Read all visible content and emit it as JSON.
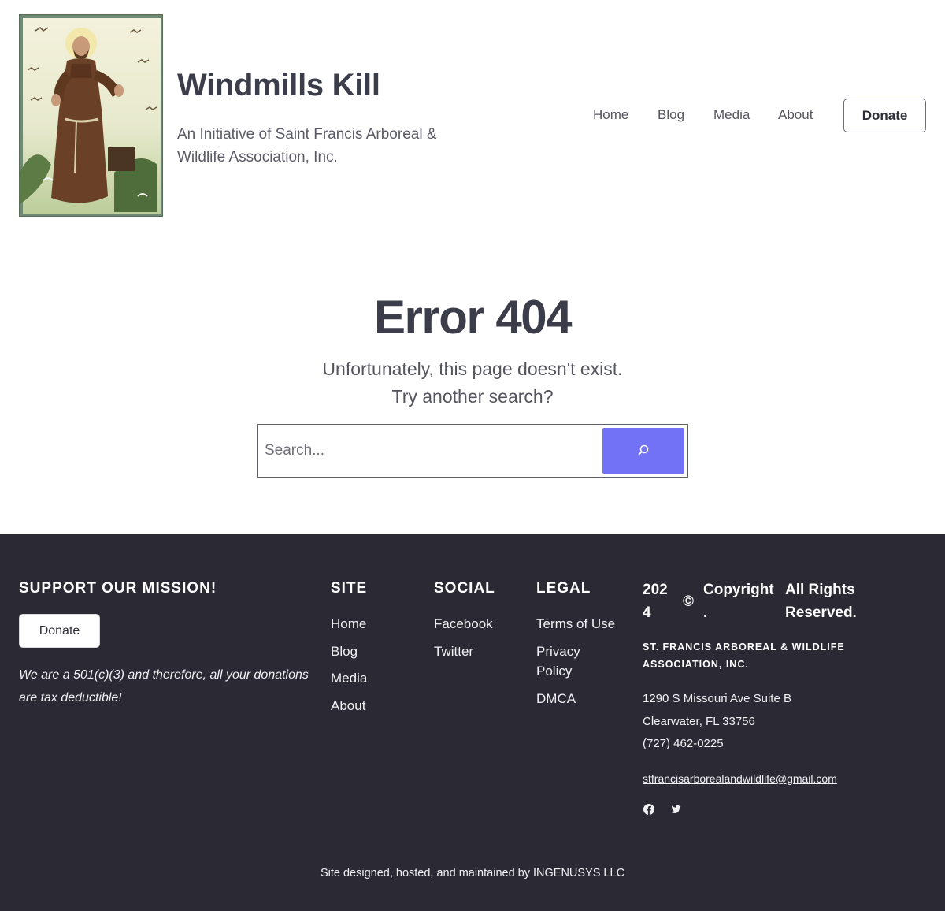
{
  "header": {
    "title": "Windmills Kill",
    "tagline": "An Initiative of Saint Francis Arboreal & Wildlife Association, Inc.",
    "nav": [
      {
        "label": "Home"
      },
      {
        "label": "Blog"
      },
      {
        "label": "Media"
      },
      {
        "label": "About"
      }
    ],
    "donate_label": "Donate"
  },
  "main": {
    "error_title": "Error 404",
    "message_line1": "Unfortunately, this page doesn't exist.",
    "message_line2": "Try another search?",
    "search_placeholder": "Search...",
    "search_button_icon": "search-icon",
    "accent_color": "#7272f7"
  },
  "footer": {
    "background_color": "#2a2934",
    "mission": {
      "heading": "SUPPORT OUR MISSION!",
      "donate_label": "Donate",
      "note": "We are a 501(c)(3) and therefore, all your donations are tax deductible!"
    },
    "site": {
      "heading": "SITE",
      "links": [
        "Home",
        "Blog",
        "Media",
        "About"
      ]
    },
    "social": {
      "heading": "SOCIAL",
      "links": [
        "Facebook",
        "Twitter"
      ]
    },
    "legal": {
      "heading": "LEGAL",
      "links": [
        "Terms of Use",
        "Privacy Policy",
        "DMCA"
      ]
    },
    "contact": {
      "year_part1": "202",
      "year_part2": "4",
      "copyright_symbol": "©",
      "copyright_word": "Copyright",
      "copyright_dot": ".",
      "rights_line1": "All Rights",
      "rights_line2": "Reserved.",
      "association": "ST. FRANCIS ARBOREAL & WILDLIFE ASSOCIATION, INC.",
      "address_line1": "1290 S Missouri Ave Suite B",
      "address_line2": "Clearwater, FL 33756",
      "phone": "(727) 462-0225",
      "email": "stfrancisarborealandwildlife@gmail.com",
      "social_icons": [
        "facebook-icon",
        "twitter-icon"
      ]
    },
    "credit": "Site designed, hosted, and maintained by INGENUSYS LLC"
  }
}
